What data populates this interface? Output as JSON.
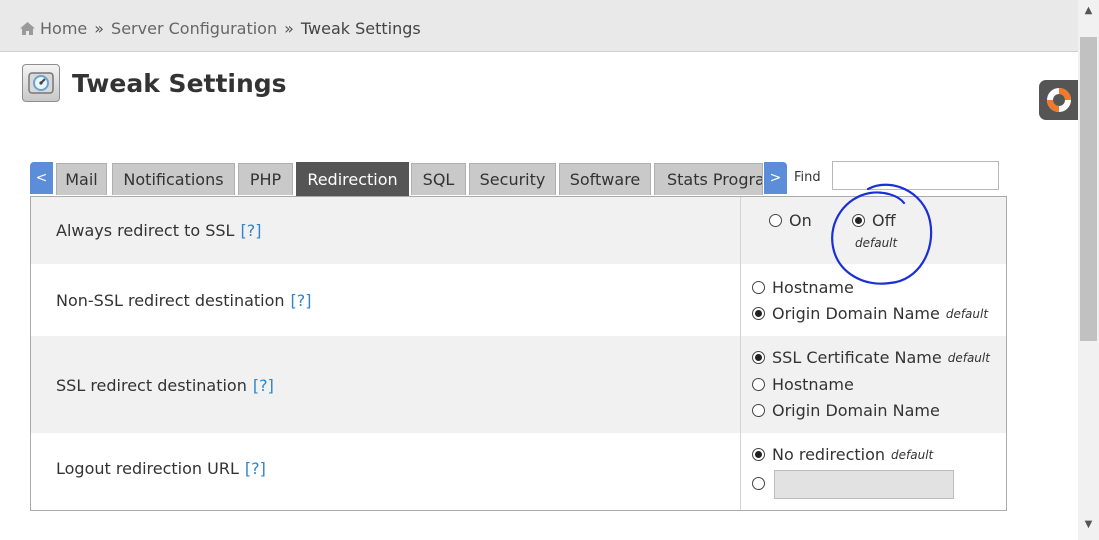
{
  "breadcrumb": {
    "home": "Home",
    "separator": "»",
    "section": "Server Configuration",
    "current": "Tweak Settings"
  },
  "page": {
    "title": "Tweak Settings",
    "icon": "tweak-settings-icon"
  },
  "help_widget": {
    "icon": "lifebuoy-icon"
  },
  "tabs": {
    "prev_arrow": "<",
    "next_arrow": ">",
    "items": [
      "Mail",
      "Notifications",
      "PHP",
      "Redirection",
      "SQL",
      "Security",
      "Software",
      "Stats Progra"
    ],
    "active": "Redirection"
  },
  "find": {
    "label": "Find",
    "value": ""
  },
  "help_link": "[?]",
  "default_tag": "default",
  "settings": [
    {
      "label": "Always redirect to SSL",
      "options": [
        {
          "label": "On",
          "checked": false
        },
        {
          "label": "Off",
          "checked": true
        }
      ]
    },
    {
      "label": "Non-SSL redirect destination",
      "options": [
        {
          "label": "Hostname",
          "checked": false
        },
        {
          "label": "Origin Domain Name",
          "checked": true
        }
      ]
    },
    {
      "label": "SSL redirect destination",
      "options": [
        {
          "label": "SSL Certificate Name",
          "checked": true
        },
        {
          "label": "Hostname",
          "checked": false
        },
        {
          "label": "Origin Domain Name",
          "checked": false
        }
      ]
    },
    {
      "label": "Logout redirection URL",
      "options": [
        {
          "label": "No redirection",
          "checked": true
        },
        {
          "label": "",
          "checked": false
        }
      ],
      "url_value": ""
    }
  ],
  "colors": {
    "accent": "#5b8dd9",
    "active_tab": "#555555",
    "link": "#2f86c9",
    "annotation": "#1a2fd6"
  }
}
